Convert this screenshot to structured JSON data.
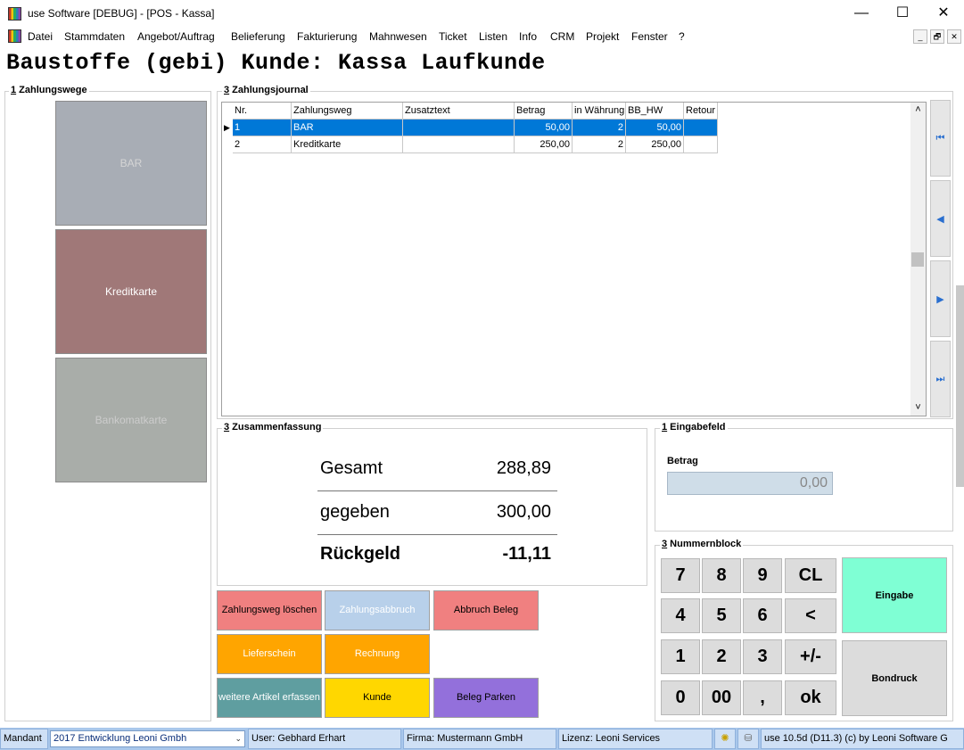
{
  "window": {
    "title": "use Software [DEBUG] - [POS - Kassa]",
    "minimize_glyph": "—",
    "maximize_glyph": "☐",
    "close_glyph": "✕"
  },
  "menu": {
    "items": [
      "Datei",
      "Stammdaten",
      "Angebot/Auftrag",
      "Belieferung",
      "Fakturierung",
      "Mahnwesen",
      "Ticket",
      "Listen",
      "Info",
      "CRM",
      "Projekt",
      "Fenster",
      "?"
    ],
    "mdi_min": "_",
    "mdi_restore": "🗗",
    "mdi_close": "✕"
  },
  "page_title": "Baustoffe (gebi) Kunde: Kassa Laufkunde",
  "zahlungswege": {
    "label_num": "1",
    "label": " Zahlungswege",
    "tiles": [
      {
        "label": "BAR",
        "color": "#a8adb5",
        "text_color": "#d5d5d5"
      },
      {
        "label": "Kreditkarte",
        "color": "#a07878",
        "text_color": "#ffffff"
      },
      {
        "label": "Bankomatkarte",
        "color": "#a9ada9",
        "text_color": "#cccccc"
      }
    ]
  },
  "journal": {
    "label_num": "3",
    "label": " Zahlungsjournal",
    "columns": [
      "Nr.",
      "Zahlungsweg",
      "Zusatztext",
      "Betrag",
      "in Währung",
      "BB_HW",
      "Retour"
    ],
    "rows": [
      [
        "1",
        "BAR",
        "",
        "50,00",
        "2",
        "50,00",
        ""
      ],
      [
        "2",
        "Kreditkarte",
        "",
        "250,00",
        "2",
        "250,00",
        ""
      ]
    ],
    "row_indicator": "▶",
    "scroll_up": "˄",
    "scroll_down": "˅"
  },
  "nav": {
    "first": "⏮",
    "prev": "◀",
    "next": "▶",
    "last": "⏭"
  },
  "summary": {
    "label_num": "3",
    "label": " Zusammenfassung",
    "gesamt_label": "Gesamt",
    "gesamt_value": "288,89",
    "gegeben_label": "gegeben",
    "gegeben_value": "300,00",
    "rueckgeld_label": "Rückgeld",
    "rueckgeld_value": "-11,11"
  },
  "eingabe": {
    "label_num": "1",
    "label": " Eingabefeld",
    "betrag_label": "Betrag",
    "betrag_value": "0,00"
  },
  "numpad": {
    "label_num": "3",
    "label": " Nummernblock",
    "keys": [
      "7",
      "8",
      "9",
      "CL",
      "4",
      "5",
      "6",
      "<",
      "1",
      "2",
      "3",
      "+/-",
      "0",
      "00",
      ",",
      "ok"
    ],
    "eingabe": "Eingabe",
    "bondruck": "Bondruck"
  },
  "actions": {
    "zahlungsweg_loeschen": "Zahlungsweg löschen",
    "zahlungsabbruch": "Zahlungsabbruch",
    "abbruch_beleg": "Abbruch Beleg",
    "lieferschein": "Lieferschein",
    "rechnung": "Rechnung",
    "weitere_artikel": "weitere Artikel erfassen",
    "kunde": "Kunde",
    "beleg_parken": "Beleg Parken"
  },
  "status": {
    "mandant_label": "Mandant",
    "mandant_value": "2017  Entwicklung Leoni Gmbh",
    "user": "User: Gebhard Erhart",
    "firma": "Firma: Mustermann GmbH",
    "lizenz": "Lizenz: Leoni Services",
    "version": "use 10.5d (D11.3) (c) by Leoni Software G",
    "caret": "⌄",
    "bulb_glyph": "✺",
    "coins_glyph": "⛁"
  },
  "colors": {
    "selection": "#0078d7",
    "btn_red": "#f08080",
    "btn_blue_disabled": "#b8d0ea",
    "btn_orange": "#ffa500",
    "btn_teal": "#5f9ea0",
    "btn_yellow": "#ffd700",
    "btn_purple": "#9370db",
    "btn_mint": "#7fffd4",
    "statusbar": "#a9c7eb"
  }
}
